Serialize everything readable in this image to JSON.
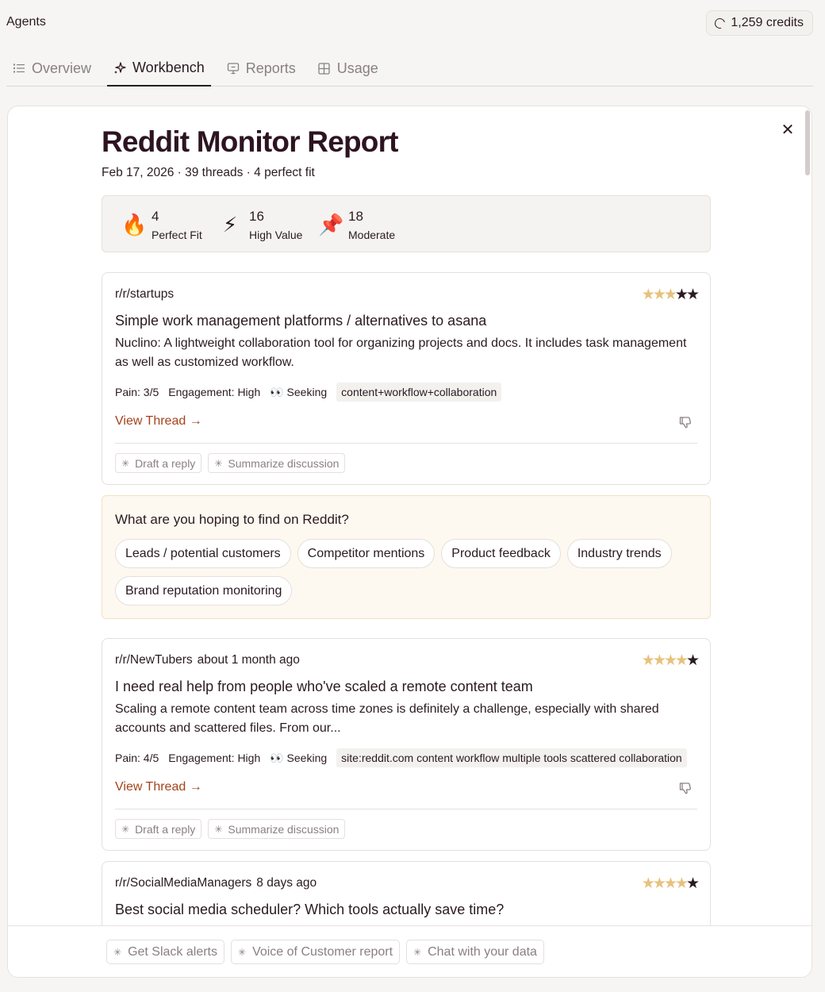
{
  "header": {
    "app_title": "Agents",
    "credits": "1,259 credits"
  },
  "tabs": [
    {
      "label": "Overview",
      "icon": "list-icon",
      "active": false
    },
    {
      "label": "Workbench",
      "icon": "sparkles-icon",
      "active": true
    },
    {
      "label": "Reports",
      "icon": "presentation-icon",
      "active": false
    },
    {
      "label": "Usage",
      "icon": "grid-icon",
      "active": false
    }
  ],
  "report": {
    "title": "Reddit Monitor Report",
    "meta": "Feb 17, 2026 · 39 threads · 4 perfect fit",
    "stats": [
      {
        "emoji": "🔥",
        "value": "4",
        "label": "Perfect Fit"
      },
      {
        "emoji": "⚡",
        "value": "16",
        "label": "High Value"
      },
      {
        "emoji": "📌",
        "value": "18",
        "label": "Moderate"
      }
    ]
  },
  "threads": [
    {
      "subreddit": "r/r/startups",
      "age": "",
      "rating": 3,
      "rating_max": 5,
      "title": "Simple work management platforms / alternatives to asana",
      "excerpt": "Nuclino: A lightweight collaboration tool for organizing projects and docs. It includes task management as well as customized workflow.",
      "pain": "Pain: 3/5",
      "engagement": "Engagement: High",
      "intent": "👀 Seeking",
      "query": "content+workflow+collaboration",
      "view_label": "View Thread →",
      "actions": [
        "Draft a reply",
        "Summarize discussion"
      ]
    },
    {
      "subreddit": "r/r/NewTubers",
      "age": "about 1 month ago",
      "rating": 4,
      "rating_max": 5,
      "title": "I need real help from people who've scaled a remote content team",
      "excerpt": "Scaling a remote content team across time zones is definitely a challenge, especially with shared accounts and scattered files. From our...",
      "pain": "Pain: 4/5",
      "engagement": "Engagement: High",
      "intent": "👀 Seeking",
      "query": "site:reddit.com content workflow multiple tools scattered collaboration",
      "view_label": "View Thread →",
      "actions": [
        "Draft a reply",
        "Summarize discussion"
      ]
    },
    {
      "subreddit": "r/r/SocialMediaManagers",
      "age": "8 days ago",
      "rating": 4,
      "rating_max": 5,
      "title": "Best social media scheduler? Which tools actually save time?"
    }
  ],
  "survey": {
    "question": "What are you hoping to find on Reddit?",
    "options": [
      "Leads / potential customers",
      "Competitor mentions",
      "Product feedback",
      "Industry trends",
      "Brand reputation monitoring"
    ]
  },
  "footer": {
    "actions": [
      "Get Slack alerts",
      "Voice of Customer report",
      "Chat with your data"
    ]
  },
  "colors": {
    "accent_link": "#a4431a",
    "star_filled": "#e8c17d",
    "star_empty": "#2a1a22",
    "survey_bg": "#fdf8f0"
  }
}
